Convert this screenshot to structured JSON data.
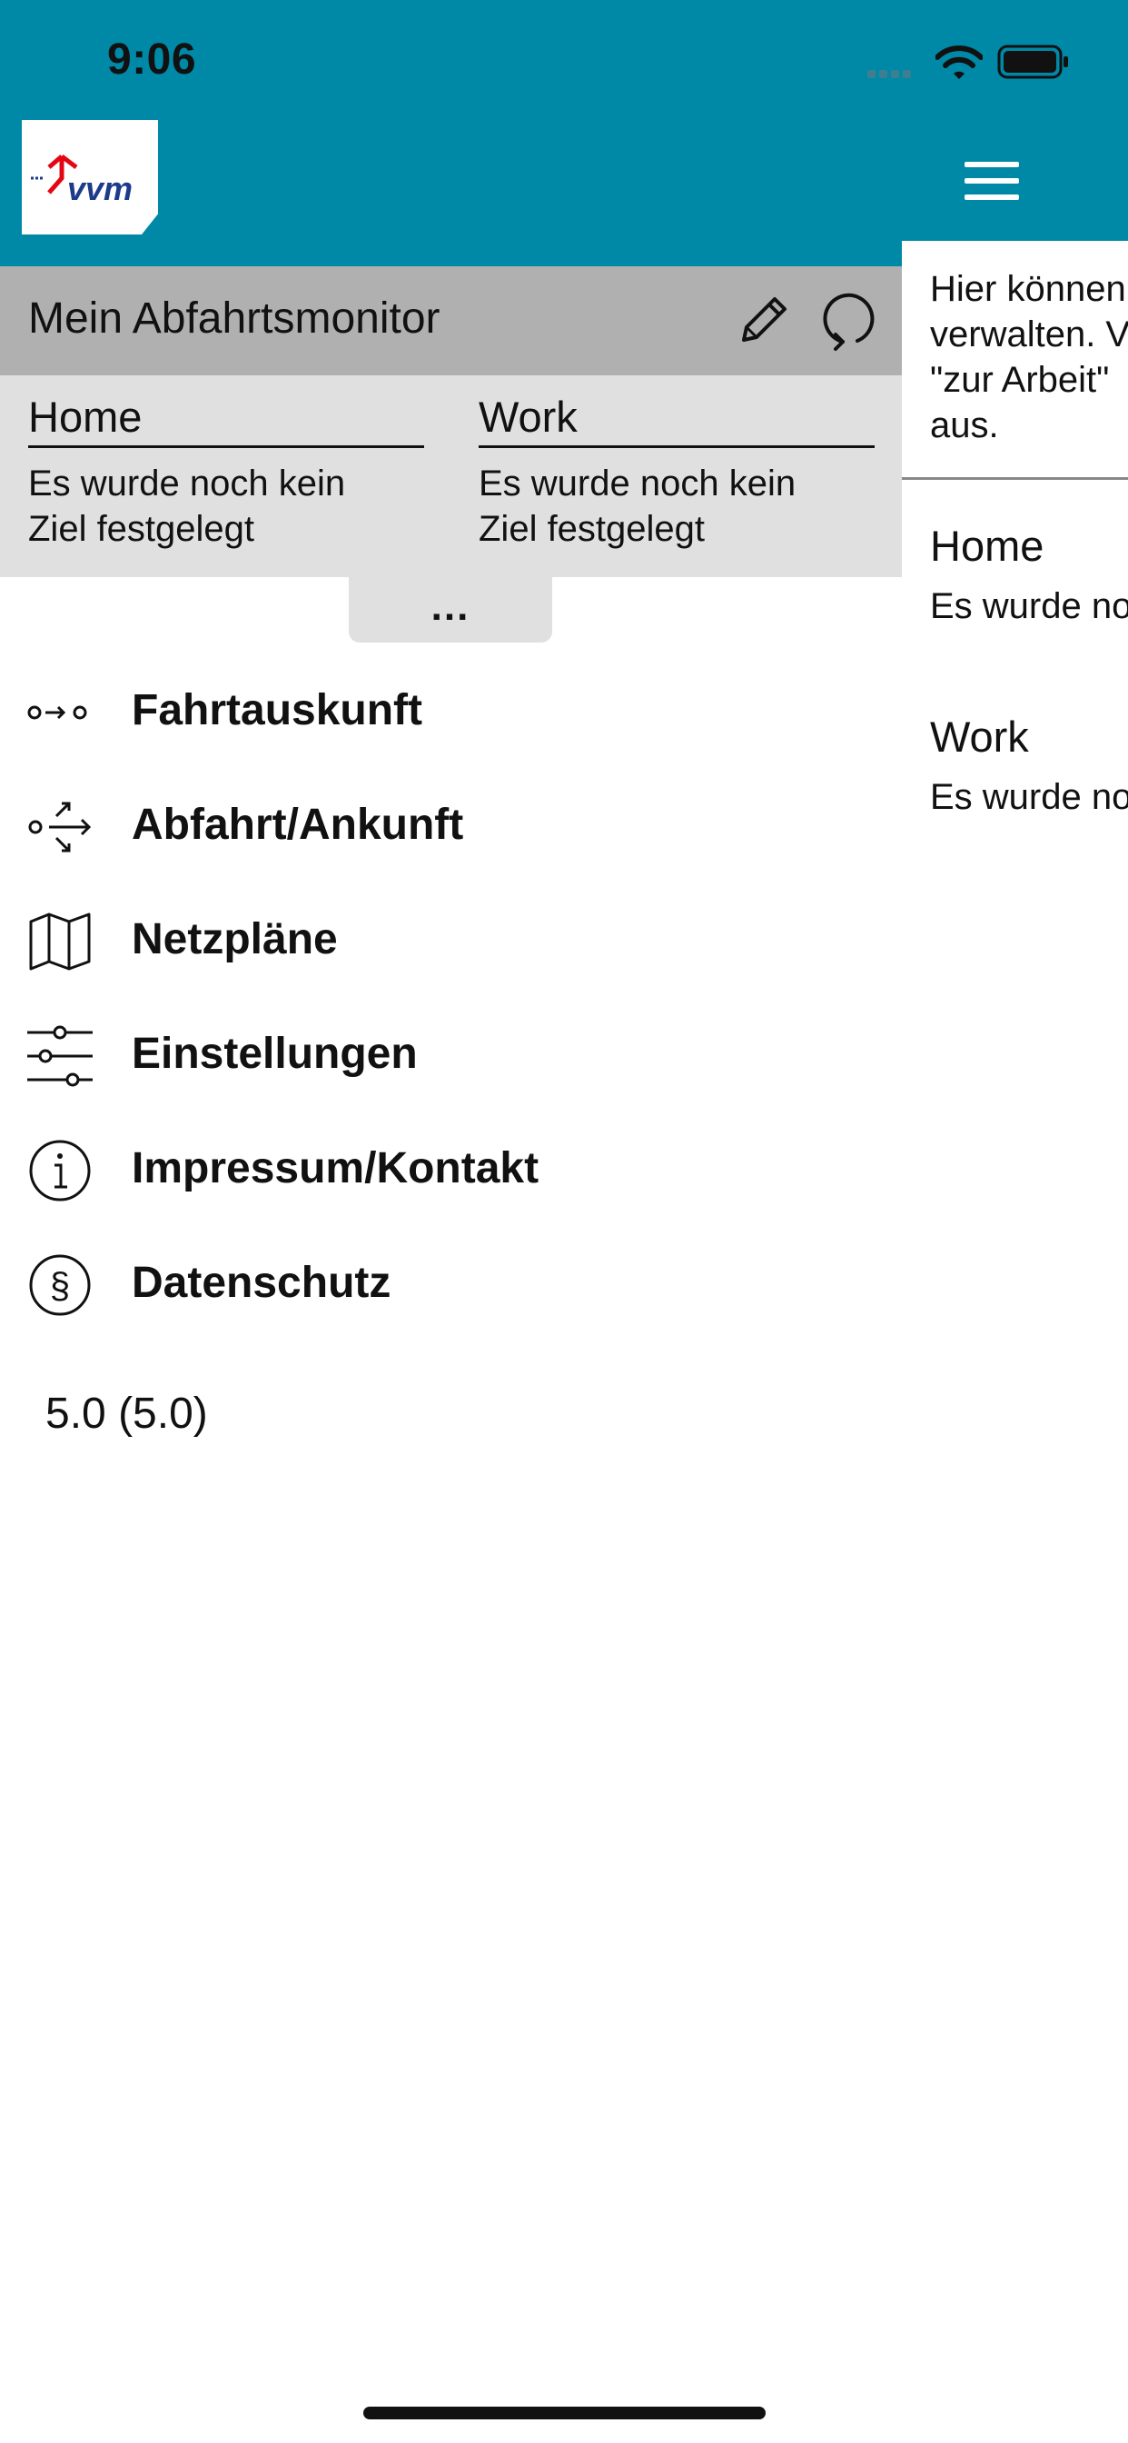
{
  "status_bar": {
    "time": "9:06"
  },
  "header": {
    "logo_text": "vvm",
    "menu_icon": "hamburger-icon"
  },
  "monitor": {
    "title": "Mein Abfahrtsmonitor",
    "targets": [
      {
        "name": "Home",
        "description_line1": "Es wurde noch kein",
        "description_line2": "Ziel festgelegt"
      },
      {
        "name": "Work",
        "description_line1": "Es wurde noch kein",
        "description_line2": "Ziel festgelegt"
      }
    ],
    "expand_label": "..."
  },
  "nav": {
    "items": [
      {
        "label": "Fahrtauskunft",
        "icon": "route-icon"
      },
      {
        "label": "Abfahrt/Ankunft",
        "icon": "departure-arrival-icon"
      },
      {
        "label": "Netzpläne",
        "icon": "map-icon"
      },
      {
        "label": "Einstellungen",
        "icon": "sliders-icon"
      },
      {
        "label": "Impressum/Kontakt",
        "icon": "info-icon"
      },
      {
        "label": "Datenschutz",
        "icon": "paragraph-icon"
      }
    ]
  },
  "version": "5.0 (5.0)",
  "right_panel": {
    "info_lines": [
      "Hier können",
      "verwalten. V",
      "\"zur Arbeit\"",
      "aus."
    ],
    "targets": [
      {
        "name": "Home",
        "description": "Es wurde no"
      },
      {
        "name": "Work",
        "description": "Es wurde no"
      }
    ]
  },
  "colors": {
    "header": "#0088a7",
    "monitor_bar": "#b0b0b0",
    "targets_bg": "#e0e0e0"
  }
}
